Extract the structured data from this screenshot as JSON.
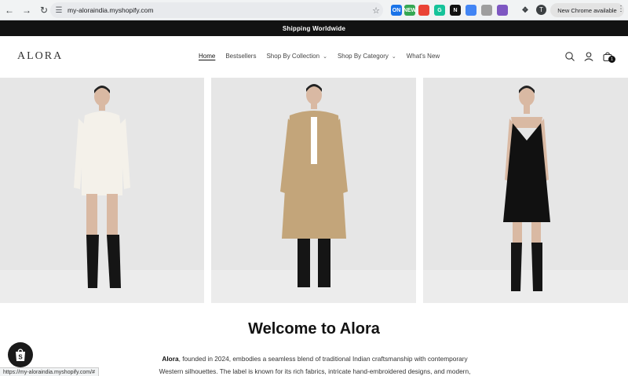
{
  "browser": {
    "url": "my-aloraindia.myshopify.com",
    "update_label": "New Chrome available",
    "profile_initial": "T",
    "extensions": [
      {
        "name": "ext-on-icon",
        "label": "ON",
        "color": "#1a73e8"
      },
      {
        "name": "ext-new-icon",
        "label": "NEW",
        "color": "#34a853"
      },
      {
        "name": "ext-color-icon",
        "label": "",
        "color": "#ea4335"
      },
      {
        "name": "ext-grammarly-icon",
        "label": "G",
        "color": "#15c39a"
      },
      {
        "name": "ext-notion-icon",
        "label": "N",
        "color": "#111111"
      },
      {
        "name": "ext-gear-icon",
        "label": "",
        "color": "#4285f4"
      },
      {
        "name": "ext-box-icon",
        "label": "",
        "color": "#9e9e9e"
      },
      {
        "name": "ext-image-icon",
        "label": "",
        "color": "#7e57c2"
      }
    ]
  },
  "announcement": "Shipping Worldwide",
  "header": {
    "logo": "ALORA",
    "nav": [
      {
        "label": "Home",
        "active": true,
        "dropdown": false
      },
      {
        "label": "Bestsellers",
        "active": false,
        "dropdown": false
      },
      {
        "label": "Shop By Collection",
        "active": false,
        "dropdown": true
      },
      {
        "label": "Shop By Category",
        "active": false,
        "dropdown": true
      },
      {
        "label": "What's New",
        "active": false,
        "dropdown": false
      }
    ],
    "cart_count": "1"
  },
  "welcome": {
    "title": "Welcome to Alora",
    "brand": "Alora",
    "body_line1": ", founded in 2024, embodies a seamless blend of traditional Indian craftsmanship with contemporary",
    "body_line2": "Western silhouettes. The label is known for its rich fabrics, intricate hand-embroidered designs, and modern,"
  },
  "status_url": "https://my-aloraindia.myshopify.com/#",
  "colors": {
    "announcement_bg": "#121212",
    "hero_bg": "#e9e9e9",
    "text": "#121212"
  }
}
